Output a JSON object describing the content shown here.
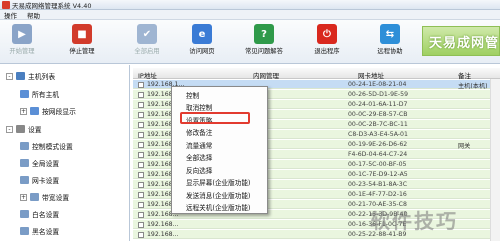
{
  "title": "天易成网络管理系统 V4.40",
  "menu": [
    "操作",
    "帮助"
  ],
  "toolbar": [
    {
      "label": "开始管理",
      "disabled": true,
      "color": "#8aa4c8",
      "glyph": "▶"
    },
    {
      "label": "停止管理",
      "disabled": false,
      "color": "#d23b2b",
      "glyph": "■"
    },
    {
      "label": "全部启用",
      "disabled": true,
      "color": "#9fb5d2",
      "glyph": "✔"
    },
    {
      "label": "访问网页",
      "disabled": false,
      "color": "#3a7bd5",
      "glyph": "e"
    },
    {
      "label": "常见问题解答",
      "disabled": false,
      "color": "#2f9a4a",
      "glyph": "?"
    },
    {
      "label": "退出程序",
      "disabled": false,
      "color": "#d9281e",
      "glyph": "⏻"
    },
    {
      "label": "远程协助",
      "disabled": false,
      "color": "#2e8fd8",
      "glyph": "⇆"
    }
  ],
  "brand": "天易成网管",
  "tree": [
    {
      "label": "主机列表",
      "expander": "-",
      "icon": "#4a7fc0"
    },
    {
      "label": "所有主机",
      "expander": "",
      "icon": "#5b8fd6"
    },
    {
      "label": "按网段显示",
      "expander": "+",
      "icon": "#5b8fd6"
    },
    {
      "label": "设置",
      "expander": "-",
      "icon": "#888888"
    },
    {
      "label": "控制模式设置",
      "expander": "",
      "icon": "#7a9cc6"
    },
    {
      "label": "全局设置",
      "expander": "",
      "icon": "#7a9cc6"
    },
    {
      "label": "网卡设置",
      "expander": "",
      "icon": "#7a9cc6"
    },
    {
      "label": "带宽设置",
      "expander": "+",
      "icon": "#7a9cc6"
    },
    {
      "label": "白名设置",
      "expander": "",
      "icon": "#7a9cc6"
    },
    {
      "label": "黑名设置",
      "expander": "",
      "icon": "#7a9cc6"
    }
  ],
  "columns": [
    "IP地址",
    "内网管理",
    "网卡地址",
    "备注"
  ],
  "rows": [
    {
      "ip": "192.168.1...",
      "mac": "00-24-1E-08-21-04",
      "note": "主机(本机)",
      "selected": true
    },
    {
      "ip": "192.168...",
      "mac": "00-26-5D-D1-9E-59",
      "note": "",
      "selected": false
    },
    {
      "ip": "192.168...",
      "mac": "00-24-01-6A-11-D7",
      "note": "",
      "selected": false
    },
    {
      "ip": "192.168...",
      "mac": "00-0C-29-E8-57-CB",
      "note": "",
      "selected": false
    },
    {
      "ip": "192.168...",
      "mac": "00-0C-2B-7C-BC-11",
      "note": "",
      "selected": false
    },
    {
      "ip": "192.168...",
      "mac": "C8-D3-A3-E4-5A-01",
      "note": "",
      "selected": false
    },
    {
      "ip": "192.168...",
      "mac": "00-19-9E-26-D6-62",
      "note": "网关",
      "selected": false
    },
    {
      "ip": "192.168...",
      "mac": "F4-6D-04-64-C7-24",
      "note": "",
      "selected": false
    },
    {
      "ip": "192.168...",
      "mac": "00-17-5C-00-BF-05",
      "note": "",
      "selected": false
    },
    {
      "ip": "192.168...",
      "mac": "00-1C-7E-D9-12-A5",
      "note": "",
      "selected": false
    },
    {
      "ip": "192.168...",
      "mac": "00-23-54-B1-8A-3C",
      "note": "",
      "selected": false
    },
    {
      "ip": "192.168...",
      "mac": "00-1E-4F-77-D2-16",
      "note": "",
      "selected": false
    },
    {
      "ip": "192.168...",
      "mac": "00-21-70-AE-35-C8",
      "note": "",
      "selected": false
    },
    {
      "ip": "192.168...",
      "mac": "00-22-15-3D-9B-40",
      "note": "",
      "selected": false
    },
    {
      "ip": "192.168...",
      "mac": "00-16-36-F1-0C-7E",
      "note": "",
      "selected": false
    },
    {
      "ip": "192.168...",
      "mac": "00-25-22-88-41-B9",
      "note": "",
      "selected": false
    }
  ],
  "context_menu": [
    "控制",
    "取消控制",
    "设置策略",
    "修改备注",
    "流量通常",
    "全部选择",
    "反向选择",
    "显示屏幕(企业版功能)",
    "发送消息(企业版功能)",
    "远程关机(企业版功能)"
  ],
  "highlighted_item": "设置策略",
  "watermark": "软件技巧"
}
